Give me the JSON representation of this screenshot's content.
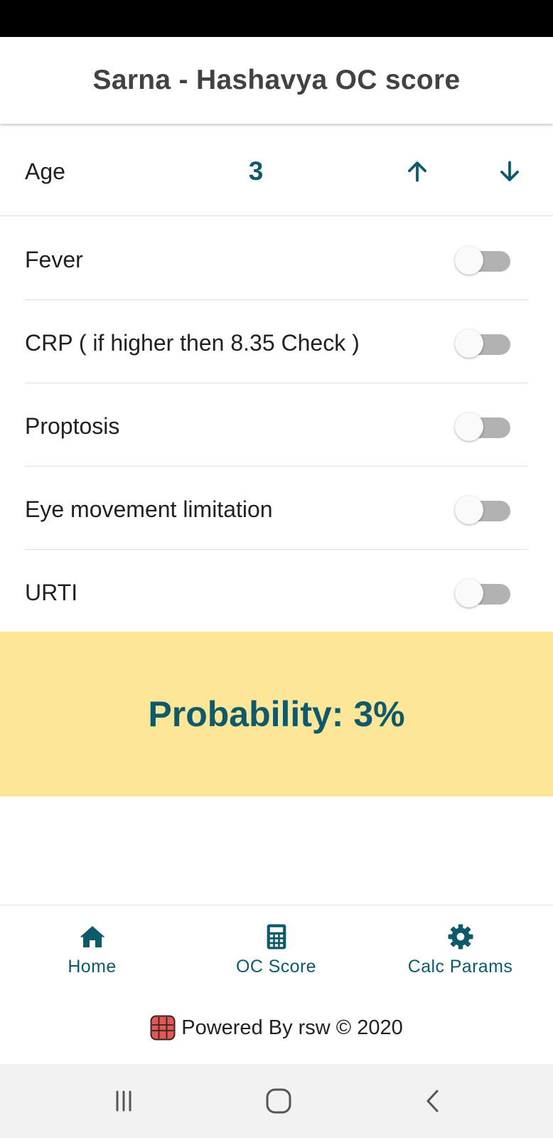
{
  "header": {
    "title": "Sarna - Hashavya OC score"
  },
  "age": {
    "label": "Age",
    "value": "3"
  },
  "criteria": [
    {
      "label": "Fever",
      "checked": false
    },
    {
      "label": "CRP ( if higher then 8.35 Check )",
      "checked": false
    },
    {
      "label": "Proptosis",
      "checked": false
    },
    {
      "label": "Eye movement limitation",
      "checked": false
    },
    {
      "label": "URTI",
      "checked": false
    }
  ],
  "result": {
    "text": "Probability: 3%"
  },
  "bottom_nav": {
    "items": [
      {
        "label": "Home",
        "icon": "home-icon"
      },
      {
        "label": "OC Score",
        "icon": "calculator-icon"
      },
      {
        "label": "Calc Params",
        "icon": "gear-icon"
      }
    ]
  },
  "footer": {
    "text": "Powered By rsw © 2020"
  },
  "colors": {
    "accent": "#0f5a6a",
    "result_background": "#fde698",
    "toggle_track": "#b2b2b2",
    "divider": "#dddddd"
  }
}
